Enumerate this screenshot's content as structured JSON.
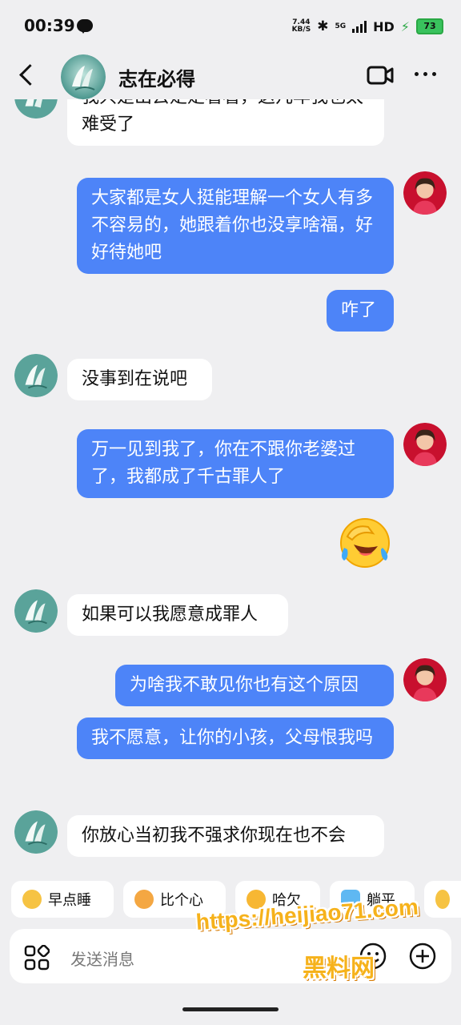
{
  "status_bar": {
    "time": "00:39",
    "net_speed_value": "7.44",
    "net_speed_unit": "KB/S",
    "network_label": "5G",
    "hd_label": "HD",
    "battery": "73"
  },
  "header": {
    "title": "志在必得"
  },
  "messages": [
    {
      "side": "in",
      "text": "我只是出去走走看看，这几年我也太难受了"
    },
    {
      "side": "out",
      "text": "大家都是女人挺能理解一个女人有多不容易的，她跟着你也没享啥福，好好待她吧"
    },
    {
      "side": "out",
      "text": "咋了"
    },
    {
      "side": "in",
      "text": "没事到在说吧"
    },
    {
      "side": "out",
      "text": "万一见到我了，你在不跟你老婆过了，我都成了千古罪人了"
    },
    {
      "side": "out",
      "emoji": "crying-laughing-emoji"
    },
    {
      "side": "in",
      "text": "如果可以我愿意成罪人"
    },
    {
      "side": "out",
      "text": "为啥我不敢见你也有这个原因"
    },
    {
      "side": "out",
      "text": "我不愿意，让你的小孩，父母恨我吗"
    },
    {
      "side": "in",
      "text": "你放心当初我不强求你现在也不会"
    }
  ],
  "quick_replies": [
    {
      "label": "早点睡",
      "icon": "sleepy-emoji-icon"
    },
    {
      "label": "比个心",
      "icon": "heart-hands-emoji-icon"
    },
    {
      "label": "哈欠",
      "icon": "yawn-emoji-icon"
    },
    {
      "label": "躺平",
      "icon": "lying-flat-emoji-icon"
    }
  ],
  "input": {
    "placeholder": "发送消息"
  },
  "watermark": {
    "url": "https://heijiao71.com",
    "brand": "黑料网"
  },
  "colors": {
    "background": "#efeff1",
    "outgoing_bubble": "#4d84f8",
    "incoming_bubble": "#ffffff",
    "battery": "#39c25d",
    "watermark": "#f6b21b"
  }
}
